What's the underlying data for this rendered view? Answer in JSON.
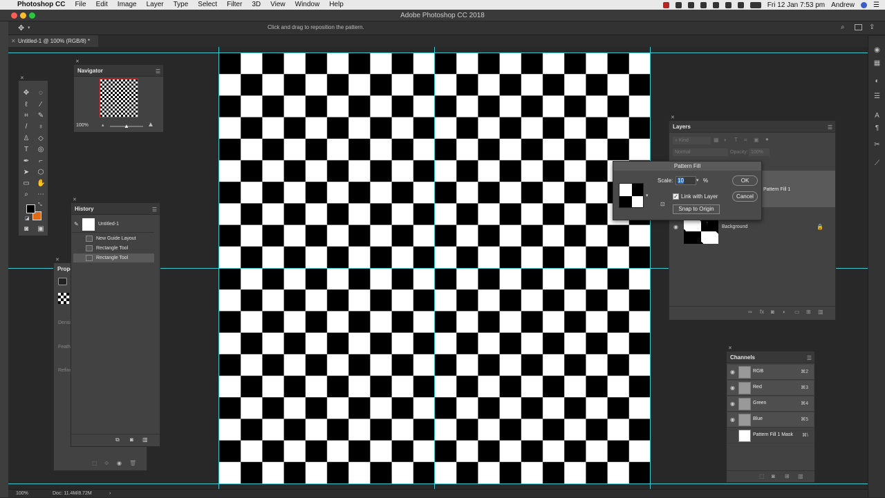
{
  "menubar": {
    "app_name": "Photoshop CC",
    "items": [
      "File",
      "Edit",
      "Image",
      "Layer",
      "Type",
      "Select",
      "Filter",
      "3D",
      "View",
      "Window",
      "Help"
    ],
    "clock": "Fri 12 Jan  7:53 pm",
    "user": "Andrew"
  },
  "window": {
    "title": "Adobe Photoshop CC 2018"
  },
  "options_bar": {
    "hint": "Click and drag to reposition the pattern."
  },
  "document_tab": {
    "label": "Untitled-1 @ 100% (RGB/8) *"
  },
  "navigator": {
    "title": "Navigator",
    "zoom": "100%"
  },
  "history": {
    "title": "History",
    "snapshot": "Untitled-1",
    "items": [
      "New Guide Layout",
      "Rectangle Tool",
      "Rectangle Tool"
    ]
  },
  "properties": {
    "title": "Prope",
    "labels": [
      "Densi",
      "Feath",
      "Refine"
    ]
  },
  "layers": {
    "title": "Layers",
    "filter_placeholder": "Kind",
    "blend_mode": "Normal",
    "opacity_label": "Opacity:",
    "opacity_value": "100%",
    "rows": [
      {
        "name": "Pattern Fill 1"
      },
      {
        "name": "Background"
      }
    ]
  },
  "dialog": {
    "title": "Pattern Fill",
    "scale_label": "Scale:",
    "scale_value": "10",
    "scale_unit": "%",
    "link_label": "Link with Layer",
    "link_checked": true,
    "snap_label": "Snap to Origin",
    "ok_label": "OK",
    "cancel_label": "Cancel"
  },
  "channels": {
    "title": "Channels",
    "rows": [
      {
        "name": "RGB",
        "shortcut": "⌘2"
      },
      {
        "name": "Red",
        "shortcut": "⌘3"
      },
      {
        "name": "Green",
        "shortcut": "⌘4"
      },
      {
        "name": "Blue",
        "shortcut": "⌘5"
      },
      {
        "name": "Pattern Fill 1 Mask",
        "shortcut": "⌘\\"
      }
    ]
  },
  "status_bar": {
    "zoom": "100%",
    "doc": "Doc: 11.4M/8.72M"
  },
  "colors": {
    "foreground": "#000000",
    "background": "#e06a14",
    "guide": "#3fc7d2",
    "accent": "#2f6fb8"
  }
}
